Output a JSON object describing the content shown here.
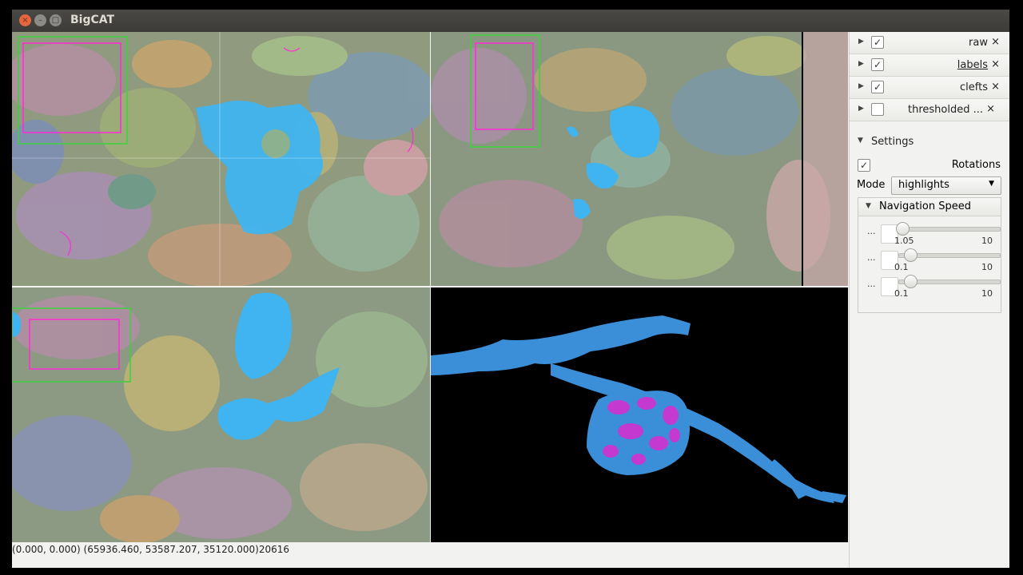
{
  "window": {
    "title": "BigCAT"
  },
  "window_controls": {
    "close": "×",
    "minimize": "–",
    "maximize": "□"
  },
  "layers": [
    {
      "name": "raw",
      "checked": true,
      "close": "×"
    },
    {
      "name": "labels",
      "checked": true,
      "close": "×"
    },
    {
      "name": "clefts",
      "checked": true,
      "close": "×"
    },
    {
      "name": "thresholded ...",
      "checked": false,
      "close": "×"
    }
  ],
  "settings": {
    "title": "Settings",
    "rotations_label": "Rotations",
    "rotations_checked": true,
    "mode_label": "Mode",
    "mode_value": "highlights",
    "navigation_speed": {
      "title": "Navigation Speed",
      "sliders": [
        {
          "dots": "···",
          "min": "1.05",
          "max": "10",
          "fraction": 0.05
        },
        {
          "dots": "···",
          "min": "0.1",
          "max": "10",
          "fraction": 0.1
        },
        {
          "dots": "···",
          "min": "0.1",
          "max": "10",
          "fraction": 0.1
        }
      ]
    }
  },
  "status_bar": {
    "text": "(0.000, 0.000) (65936.460, 53587.207, 35120.000)20616"
  },
  "colors": {
    "segment_highlight": "#3fb4f0",
    "clefts": "#ff2ad4",
    "mesh_blue": "#3a8fd8",
    "mesh_magenta": "#c43ad0",
    "titlebar": "#3c3b37"
  }
}
